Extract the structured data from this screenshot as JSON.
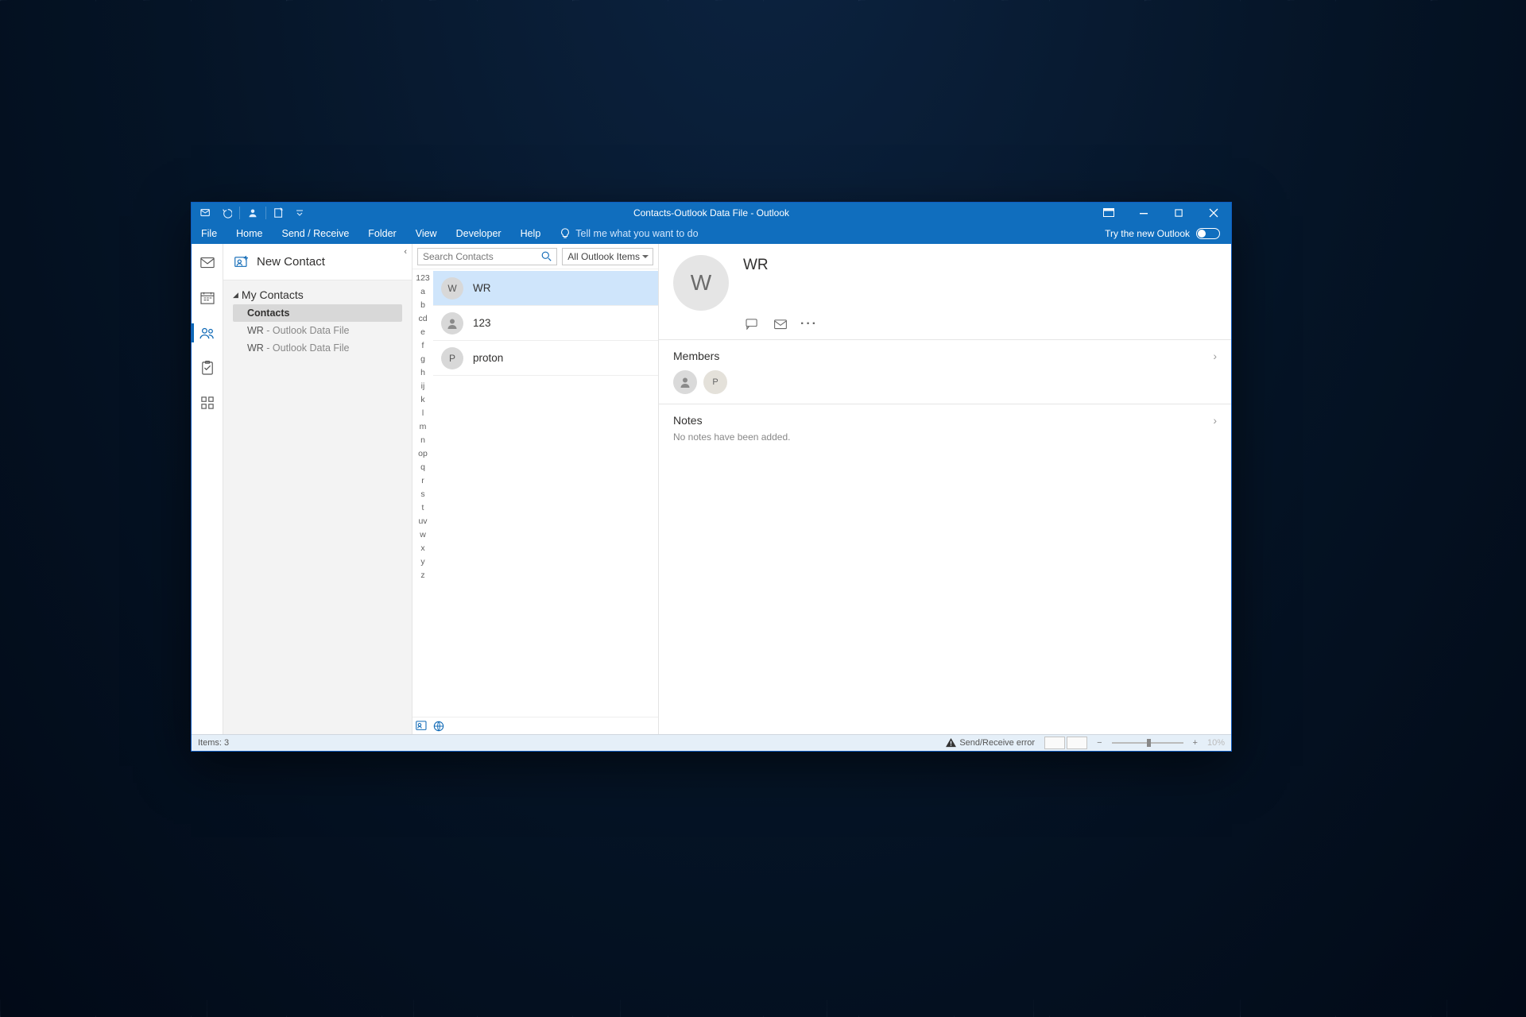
{
  "window_title": "Contacts-Outlook Data File  -  Outlook",
  "menu": {
    "items": [
      "File",
      "Home",
      "Send / Receive",
      "Folder",
      "View",
      "Developer",
      "Help"
    ],
    "tell_me": "Tell me what you want to do",
    "try_new": "Try the new Outlook"
  },
  "nav": {
    "new_contact": "New Contact",
    "group_header": "My Contacts",
    "items": [
      {
        "label": "Contacts",
        "selected": true
      },
      {
        "label": "WR",
        "suffix": " - Outlook Data File"
      },
      {
        "label": "WR",
        "suffix": " - Outlook Data File"
      }
    ]
  },
  "search": {
    "placeholder": "Search Contacts",
    "scope": "All Outlook Items"
  },
  "alpha_index": [
    "123",
    "a",
    "b",
    "cd",
    "e",
    "f",
    "g",
    "h",
    "ij",
    "k",
    "l",
    "m",
    "n",
    "op",
    "q",
    "r",
    "s",
    "t",
    "uv",
    "w",
    "x",
    "y",
    "z"
  ],
  "contacts": [
    {
      "name": "WR",
      "avatar_text": "W",
      "selected": true
    },
    {
      "name": "123",
      "avatar_text": "",
      "selected": false
    },
    {
      "name": "proton",
      "avatar_text": "P",
      "selected": false
    }
  ],
  "detail": {
    "avatar": "W",
    "name": "WR",
    "members_header": "Members",
    "members": [
      {
        "avatar_text": ""
      },
      {
        "avatar_text": "P"
      }
    ],
    "notes_header": "Notes",
    "notes_empty": "No notes have been added."
  },
  "statusbar": {
    "items": "Items: 3",
    "error": "Send/Receive error",
    "zoom": "10%"
  }
}
